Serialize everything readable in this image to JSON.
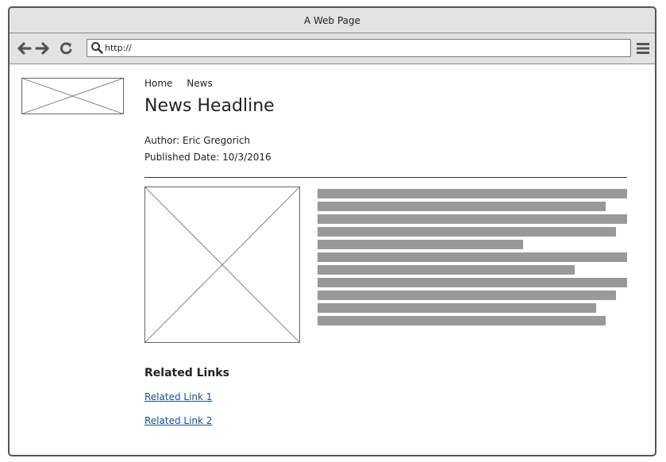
{
  "window": {
    "title": "A Web Page"
  },
  "toolbar": {
    "back_icon": "arrow-left-icon",
    "forward_icon": "arrow-right-icon",
    "reload_icon": "reload-icon",
    "search_icon": "search-icon",
    "menu_icon": "hamburger-menu-icon",
    "url": "http://"
  },
  "page": {
    "breadcrumb": [
      "Home",
      "News"
    ],
    "headline": "News Headline",
    "author": "Author: Eric Gregorich",
    "published": "Published Date: 10/3/2016",
    "related": {
      "title": "Related Links",
      "links": [
        "Related Link 1",
        "Related Link 2"
      ]
    }
  },
  "colors": {
    "chrome_bg": "#e3e3e3",
    "placeholder_line": "#999999",
    "link": "#1a4f8a"
  }
}
